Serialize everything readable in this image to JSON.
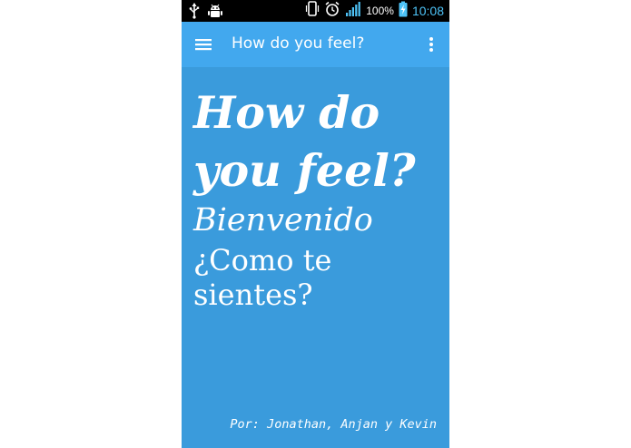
{
  "status_bar": {
    "icons": [
      "usb-icon",
      "android-debug-icon",
      "vibrate-icon",
      "alarm-icon",
      "signal-icon",
      "battery-charging-icon"
    ],
    "battery_percent": "100%",
    "time": "10:08"
  },
  "toolbar": {
    "menu_icon": "hamburger-menu-icon",
    "title": "How do you feel?",
    "overflow_icon": "overflow-menu-icon"
  },
  "main": {
    "headline": "How do you feel?",
    "welcome": "Bienvenido",
    "question": "¿Como te sientes?",
    "credits": "Por: Jonathan, Anjan y Kevin"
  },
  "colors": {
    "background": "#3a9bdc",
    "toolbar": "#42a8ee",
    "status_bar": "#000000",
    "clock": "#4ec3f7",
    "text": "#ffffff"
  }
}
